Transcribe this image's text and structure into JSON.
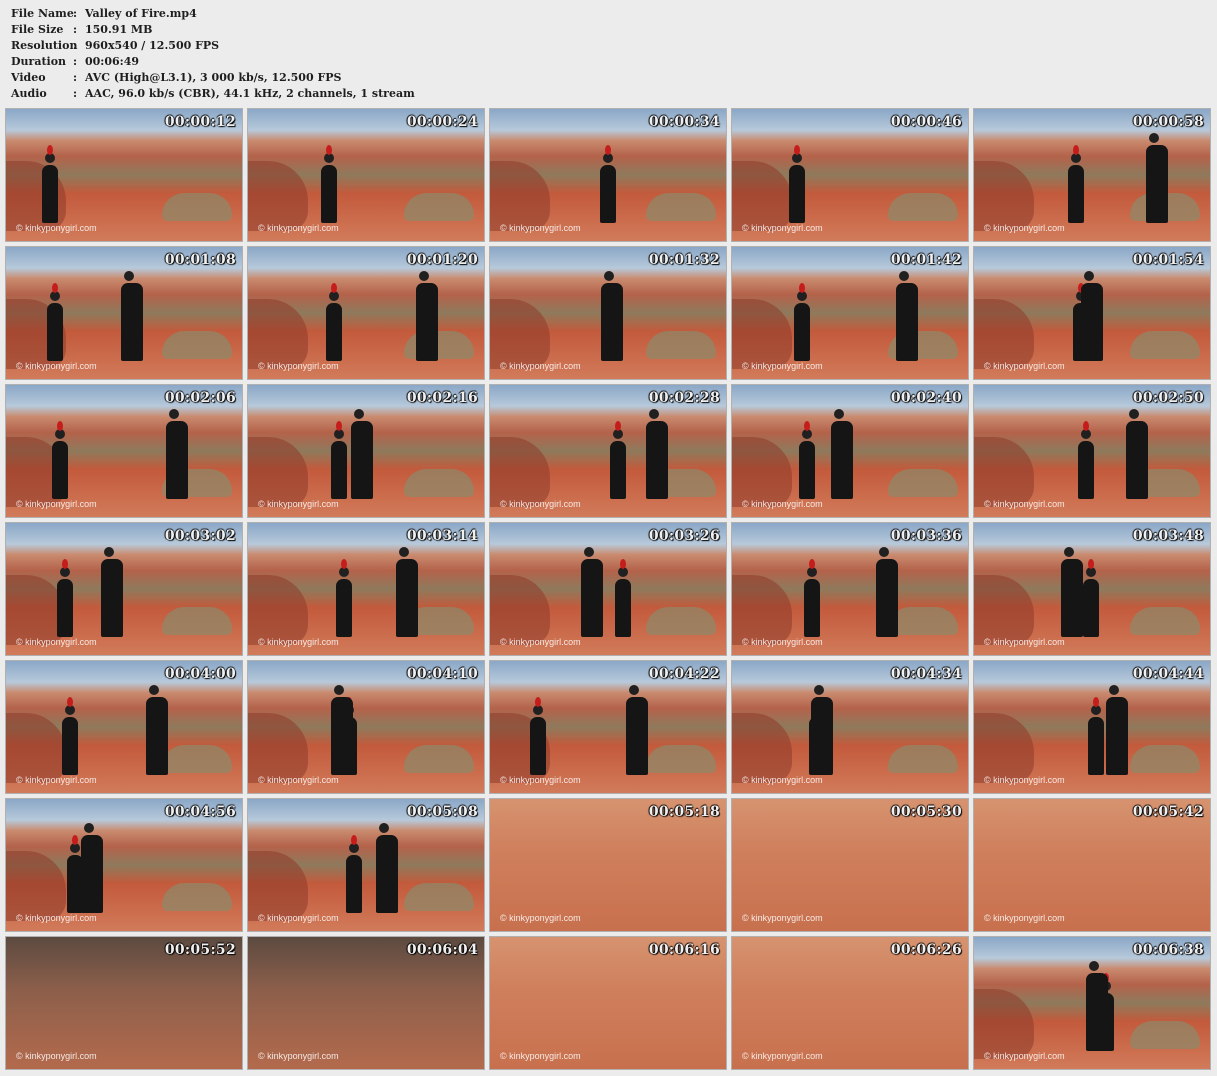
{
  "info": [
    {
      "label": "File Name",
      "value": "Valley of Fire.mp4"
    },
    {
      "label": "File Size",
      "value": "150.91 MB"
    },
    {
      "label": "Resolution",
      "value": "960x540 / 12.500 FPS"
    },
    {
      "label": "Duration",
      "value": "00:06:49"
    },
    {
      "label": "Video",
      "value": "AVC (High@L3.1), 3 000 kb/s, 12.500 FPS"
    },
    {
      "label": "Audio",
      "value": "AAC, 96.0 kb/s (CBR), 44.1 kHz, 2 channels, 1 stream"
    }
  ],
  "colon": ":",
  "watermark": "© kinkyponygirl.com",
  "thumbnails": [
    {
      "ts": "00:00:12",
      "scene": "wide"
    },
    {
      "ts": "00:00:24",
      "scene": "wide"
    },
    {
      "ts": "00:00:34",
      "scene": "wide"
    },
    {
      "ts": "00:00:46",
      "scene": "wide"
    },
    {
      "ts": "00:00:58",
      "scene": "wide"
    },
    {
      "ts": "00:01:08",
      "scene": "wide"
    },
    {
      "ts": "00:01:20",
      "scene": "wide"
    },
    {
      "ts": "00:01:32",
      "scene": "wide"
    },
    {
      "ts": "00:01:42",
      "scene": "wide"
    },
    {
      "ts": "00:01:54",
      "scene": "wide"
    },
    {
      "ts": "00:02:06",
      "scene": "wide"
    },
    {
      "ts": "00:02:16",
      "scene": "wide"
    },
    {
      "ts": "00:02:28",
      "scene": "wide"
    },
    {
      "ts": "00:02:40",
      "scene": "wide"
    },
    {
      "ts": "00:02:50",
      "scene": "wide"
    },
    {
      "ts": "00:03:02",
      "scene": "wide"
    },
    {
      "ts": "00:03:14",
      "scene": "wide"
    },
    {
      "ts": "00:03:26",
      "scene": "wide"
    },
    {
      "ts": "00:03:36",
      "scene": "wide"
    },
    {
      "ts": "00:03:48",
      "scene": "wide"
    },
    {
      "ts": "00:04:00",
      "scene": "wide"
    },
    {
      "ts": "00:04:10",
      "scene": "wide"
    },
    {
      "ts": "00:04:22",
      "scene": "wide"
    },
    {
      "ts": "00:04:34",
      "scene": "wide"
    },
    {
      "ts": "00:04:44",
      "scene": "wide"
    },
    {
      "ts": "00:04:56",
      "scene": "wide"
    },
    {
      "ts": "00:05:08",
      "scene": "wide"
    },
    {
      "ts": "00:05:18",
      "scene": "close"
    },
    {
      "ts": "00:05:30",
      "scene": "close"
    },
    {
      "ts": "00:05:42",
      "scene": "close"
    },
    {
      "ts": "00:05:52",
      "scene": "dark"
    },
    {
      "ts": "00:06:04",
      "scene": "dark"
    },
    {
      "ts": "00:06:16",
      "scene": "close"
    },
    {
      "ts": "00:06:26",
      "scene": "close"
    },
    {
      "ts": "00:06:38",
      "scene": "wide"
    }
  ]
}
